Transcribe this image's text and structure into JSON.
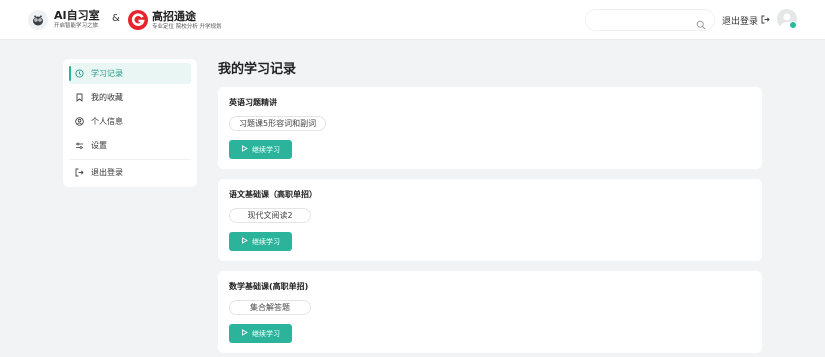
{
  "header": {
    "brand1_title": "AI自习室",
    "brand1_subtitle": "开启智能学习之旅",
    "amp": "&",
    "brand2_title": "高招通途",
    "brand2_subtitle": "专业定位 院校分析 升学规划",
    "search_placeholder": "",
    "logout_label": "退出登录"
  },
  "sidebar": {
    "items": [
      {
        "label": "学习记录",
        "icon": "history-icon",
        "active": true
      },
      {
        "label": "我的收藏",
        "icon": "bookmark-icon",
        "active": false
      },
      {
        "label": "个人信息",
        "icon": "user-icon",
        "active": false
      },
      {
        "label": "设置",
        "icon": "settings-icon",
        "active": false
      },
      {
        "label": "退出登录",
        "icon": "logout-icon",
        "active": false
      }
    ]
  },
  "main": {
    "title": "我的学习记录",
    "records": [
      {
        "course": "英语习题精讲",
        "lesson": "习题课5形容词和副词",
        "button": "继续学习"
      },
      {
        "course": "语文基础课（高职单招）",
        "lesson": "现代文阅读2",
        "button": "继续学习"
      },
      {
        "course": "数学基础课(高职单招)",
        "lesson": "集合解答题",
        "button": "继续学习"
      }
    ]
  },
  "colors": {
    "accent": "#2bb39b",
    "active_bg": "#eaf6f3",
    "page_bg": "#f1f3f5",
    "brand2_red": "#e8232b"
  }
}
